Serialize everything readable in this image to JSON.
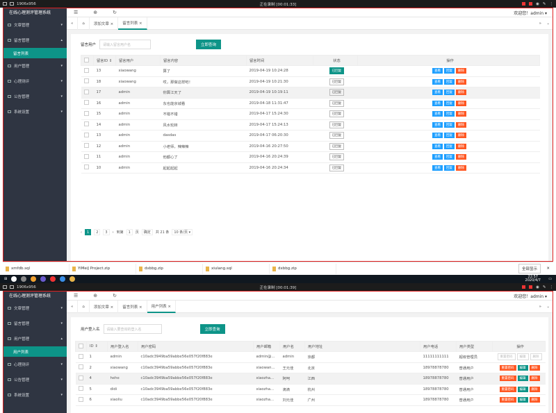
{
  "recorder": {
    "left_label": "1906x956",
    "center": "正在录制 [00:01:33]",
    "center2": "正在录制 [00:01:39]"
  },
  "app": {
    "title": "在线心理测评管理系统",
    "user": "欢迎您！admin ▾"
  },
  "sidebar": {
    "items": [
      {
        "label": "文章管理",
        "arrow": "▾"
      },
      {
        "label": "留言管理",
        "arrow": "▴"
      },
      {
        "label": "用户管理",
        "arrow": "▾"
      },
      {
        "label": "心理测评",
        "arrow": "▾"
      },
      {
        "label": "公告管理",
        "arrow": "▾"
      },
      {
        "label": "系统设置",
        "arrow": "▾"
      }
    ],
    "sub": "留言列表"
  },
  "tabs": [
    {
      "label": "添加文章 ×"
    },
    {
      "label": "留言列表 ×"
    }
  ],
  "search": {
    "label": "留言用户",
    "placeholder": "请输入留言用户名",
    "button": "立即查询"
  },
  "table": {
    "headers": [
      "",
      "留言ID ⇕",
      "留言用户",
      "留言内容",
      "留言时间",
      "状态",
      "操作"
    ],
    "rows": [
      {
        "id": "13",
        "user": "xiaowang",
        "content": "算了",
        "time": "2019-04-19 10:24:28",
        "status": "已回复",
        "on": true
      },
      {
        "id": "18",
        "user": "xiaowang",
        "content": "哎，那做这样吧！",
        "time": "2019-04-19 10:21:30",
        "status": "已回复",
        "on": false
      },
      {
        "id": "17",
        "user": "admin",
        "content": "你算江天了",
        "time": "2019-04-19 10:19:11",
        "status": "已回复",
        "on": false
      },
      {
        "id": "16",
        "user": "admin",
        "content": "东也能京城看",
        "time": "2019-04-18 11:31:47",
        "status": "已回复",
        "on": false
      },
      {
        "id": "15",
        "user": "admin",
        "content": "不错不错",
        "time": "2019-04-17 15:24:30",
        "status": "已回复",
        "on": false
      },
      {
        "id": "14",
        "user": "admin",
        "content": "风水轮转",
        "time": "2019-04-17 15:24:13",
        "status": "已回复",
        "on": false
      },
      {
        "id": "13",
        "user": "admin",
        "content": "dasdas",
        "time": "2019-04-17 06:20:30",
        "status": "已回复",
        "on": false
      },
      {
        "id": "12",
        "user": "admin",
        "content": "小老师，辣辣辣",
        "time": "2019-04-16 20:27:50",
        "status": "已回复",
        "on": false
      },
      {
        "id": "11",
        "user": "admin",
        "content": "他都心了",
        "time": "2019-04-16 20:24:39",
        "status": "已回复",
        "on": false
      },
      {
        "id": "10",
        "user": "admin",
        "content": "起起起起",
        "time": "2019-04-16 20:24:34",
        "status": "已回复",
        "on": false
      }
    ],
    "actions": [
      "查看",
      "回复",
      "删除"
    ]
  },
  "pager": {
    "pages": [
      "1",
      "2",
      "3"
    ],
    "goto": "到第",
    "goto_val": "1",
    "unit": "页",
    "confirm": "确定",
    "total": "共 21 条",
    "size": "10 条/页 ▾"
  },
  "downloads": [
    {
      "name": "xmfdb.sql"
    },
    {
      "name": "YiMeiJ Project.zip"
    },
    {
      "name": "dxbbg.zip"
    },
    {
      "name": "xiulang.sql"
    },
    {
      "name": "dxbbg.zip"
    }
  ],
  "downloads_show_all": "全部显示",
  "taskbar": {
    "time": "22:57",
    "date": "2020/4/7"
  },
  "screen2": {
    "tabs": [
      {
        "label": "添加文章 ×"
      },
      {
        "label": "留言列表 ×"
      },
      {
        "label": "用户列表 ×"
      }
    ],
    "sub": "用户列表",
    "search": {
      "label": "用户登入名",
      "placeholder": "请输入要查询的登入名",
      "button": "立即查询"
    },
    "headers": [
      "",
      "ID ⇕",
      "用户登入名",
      "用户密码",
      "用户邮箱",
      "用户名",
      "用户地址",
      "用户电话",
      "用户类型",
      "操作"
    ],
    "rows": [
      {
        "id": "1",
        "login": "admin",
        "pwd": "c10adc3949ba59abbe56e057f20f883e",
        "mail": "admin@...",
        "name": "admin",
        "addr": "京都",
        "tel": "11111111111",
        "type": "超级管理员"
      },
      {
        "id": "2",
        "login": "xiaowang",
        "pwd": "c10adc3949ba59abbe56e057f20f883e",
        "mail": "xiaowan...",
        "name": "王元佳",
        "addr": "北京",
        "tel": "18978878780",
        "type": "普通用户"
      },
      {
        "id": "4",
        "login": "hehe",
        "pwd": "c10adc3949ba59abbe56e057f20f883e",
        "mail": "xiaozha...",
        "name": "阿呵",
        "addr": "江西",
        "tel": "18978878780",
        "type": "普通用户"
      },
      {
        "id": "5",
        "login": "didi",
        "pwd": "c10adc3949ba59abbe56e057f20f883e",
        "mail": "xiaozha...",
        "name": "滴滴",
        "addr": "杭州",
        "tel": "18978878780",
        "type": "普通用户"
      },
      {
        "id": "6",
        "login": "xiaoliu",
        "pwd": "c10adc3949ba59abbe56e057f20f883e",
        "mail": "xiaozha...",
        "name": "刘元佳",
        "addr": "广州",
        "tel": "18978878780",
        "type": "普通用户"
      }
    ],
    "actions": [
      "重置密码",
      "编辑",
      "删除"
    ]
  }
}
